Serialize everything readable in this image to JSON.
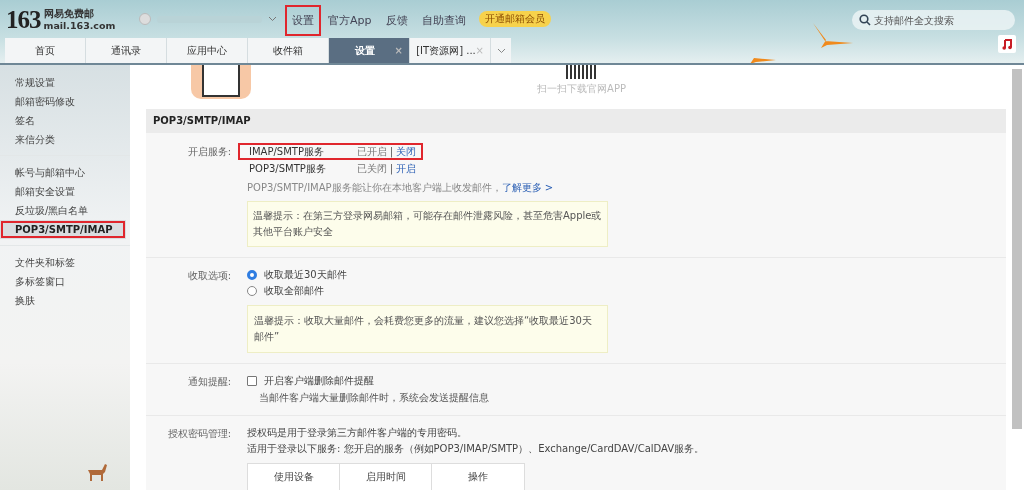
{
  "header": {
    "logo": {
      "number": "163",
      "name": "网易免费邮",
      "domain": "mail.163.com"
    },
    "nav_links": [
      {
        "label": "设置",
        "highlighted": true
      },
      {
        "label": "官方App",
        "highlighted": false
      },
      {
        "label": "反馈",
        "highlighted": false
      },
      {
        "label": "自助查询",
        "highlighted": false
      }
    ],
    "vip_badge": "开通邮箱会员",
    "search": {
      "placeholder": "支持邮件全文搜索"
    }
  },
  "tabs": [
    {
      "label": "首页",
      "selected": false
    },
    {
      "label": "通讯录",
      "selected": false
    },
    {
      "label": "应用中心",
      "selected": false
    },
    {
      "label": "收件箱",
      "selected": false
    },
    {
      "label": "设置",
      "selected": true,
      "close": "×"
    },
    {
      "label": "[IT资源网] ...",
      "selected": false,
      "close": "×"
    }
  ],
  "sidebar": {
    "groups": [
      {
        "items": [
          {
            "label": "常规设置",
            "selected": false
          },
          {
            "label": "邮箱密码修改",
            "selected": false
          },
          {
            "label": "签名",
            "selected": false
          },
          {
            "label": "来信分类",
            "selected": false
          }
        ]
      },
      {
        "items": [
          {
            "label": "帐号与邮箱中心",
            "selected": false
          },
          {
            "label": "邮箱安全设置",
            "selected": false
          },
          {
            "label": "反垃圾/黑白名单",
            "selected": false
          },
          {
            "label": "POP3/SMTP/IMAP",
            "selected": true
          }
        ]
      },
      {
        "items": [
          {
            "label": "文件夹和标签",
            "selected": false
          },
          {
            "label": "多标签窗口",
            "selected": false
          },
          {
            "label": "换肤",
            "selected": false
          }
        ]
      }
    ]
  },
  "promo": {
    "qr_caption": "扫一扫下载官网APP"
  },
  "section": {
    "title": "POP3/SMTP/IMAP",
    "services": {
      "label": "开启服务:",
      "rows": [
        {
          "name": "IMAP/SMTP服务",
          "status": "已开启",
          "separator": "|",
          "action": "关闭",
          "highlighted": true
        },
        {
          "name": "POP3/SMTP服务",
          "status": "已关闭",
          "separator": "|",
          "action": "开启",
          "highlighted": false
        }
      ],
      "description": "POP3/SMTP/IMAP服务能让你在本地客户端上收发邮件，",
      "learn_more": "了解更多 >",
      "tip": "温馨提示：在第三方登录网易邮箱，可能存在邮件泄露风险，甚至危害Apple或其他平台账户安全"
    },
    "receive": {
      "label": "收取选项:",
      "options": [
        {
          "label": "收取最近30天邮件",
          "selected": true
        },
        {
          "label": "收取全部邮件",
          "selected": false
        }
      ],
      "tip": "温馨提示：收取大量邮件，会耗费您更多的流量，建议您选择“收取最近30天邮件”"
    },
    "notify": {
      "label": "通知提醒:",
      "checkbox": {
        "label": "开启客户端删除邮件提醒",
        "checked": false
      },
      "hint": "当邮件客户端大量删除邮件时，系统会发送提醒信息"
    },
    "auth": {
      "label": "授权密码管理:",
      "lines": [
        "授权码是用于登录第三方邮件客户端的专用密码。",
        "适用于登录以下服务: 您开启的服务（例如POP3/IMAP/SMTP）、Exchange/CardDAV/CalDAV服务。"
      ],
      "table": {
        "columns": [
          "使用设备",
          "启用时间",
          "操作"
        ]
      }
    }
  }
}
